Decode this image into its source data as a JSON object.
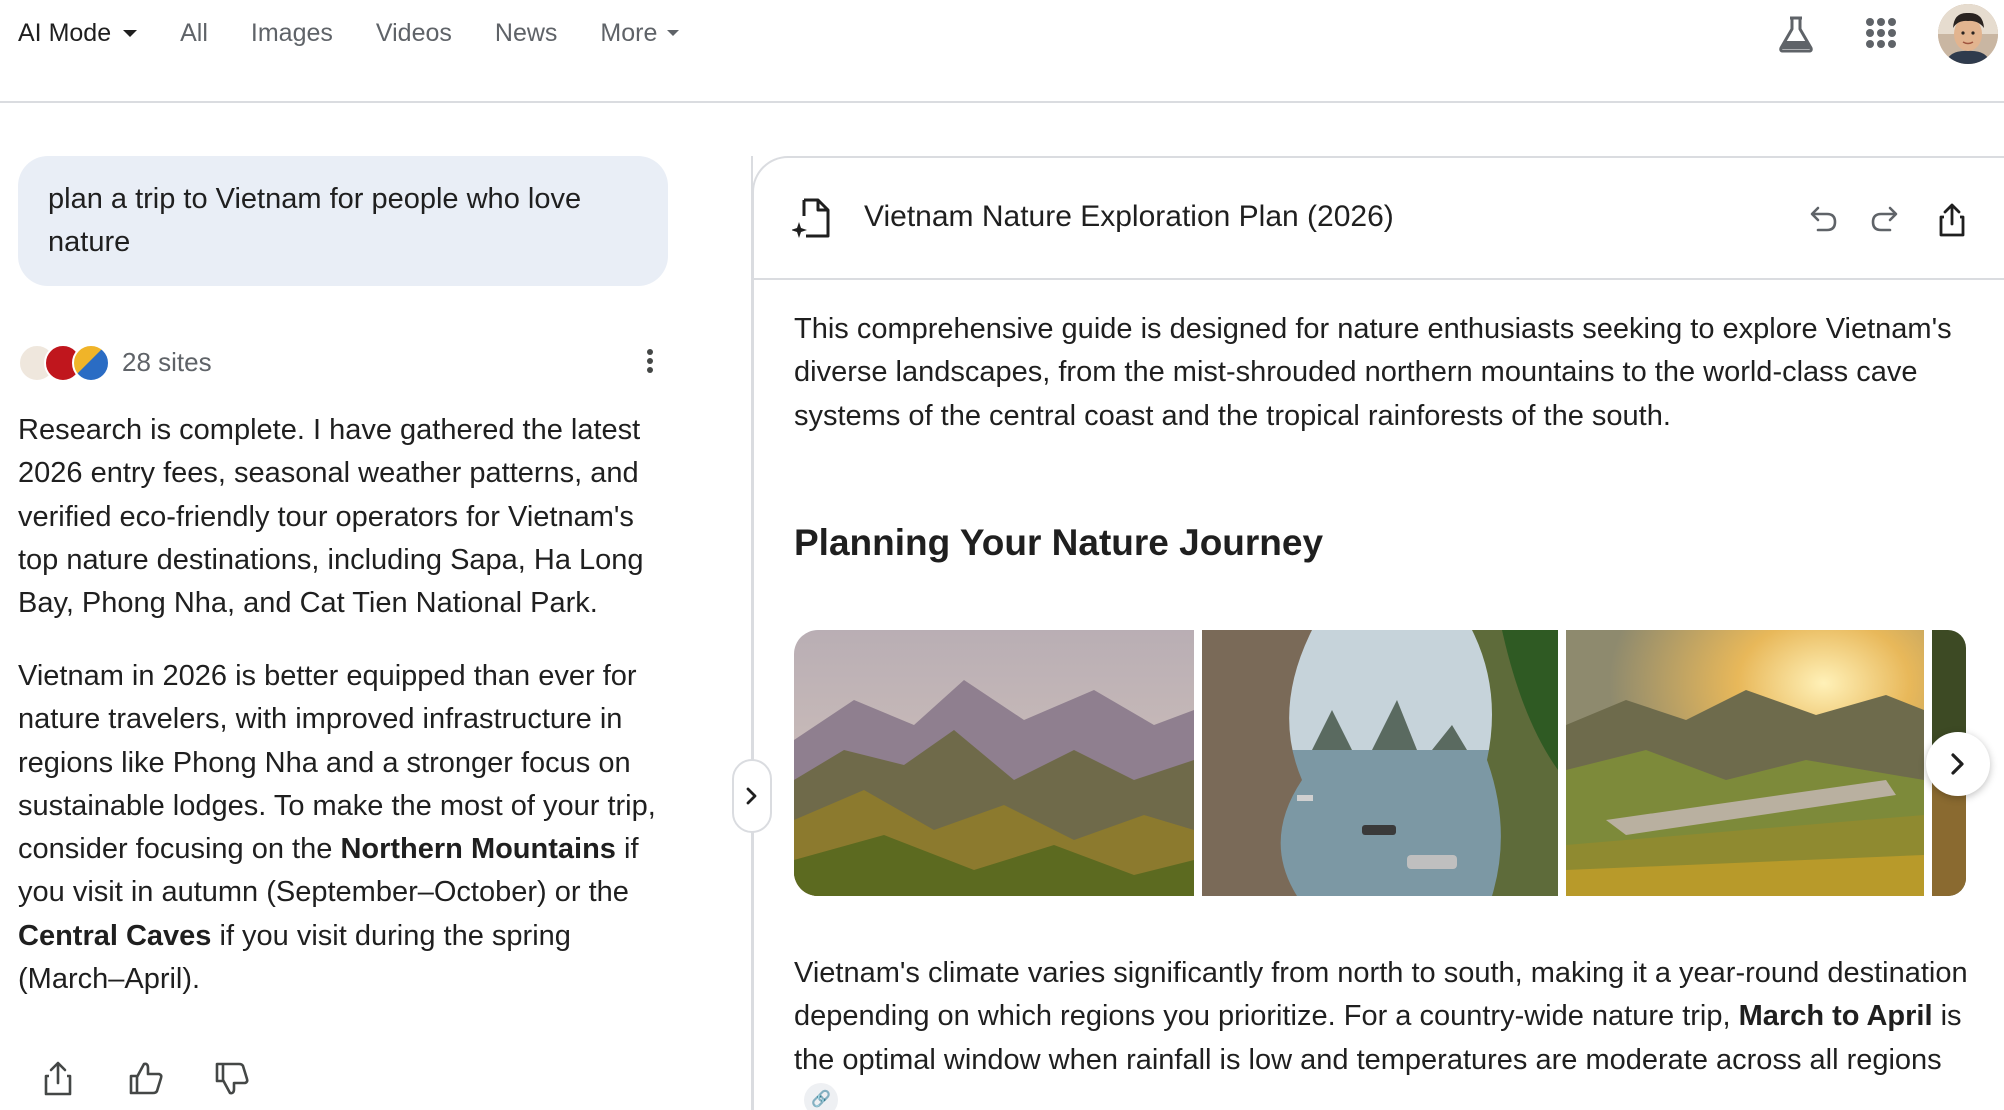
{
  "nav": {
    "items": [
      {
        "label": "AI Mode",
        "active": true
      },
      {
        "label": "All"
      },
      {
        "label": "Images"
      },
      {
        "label": "Videos"
      },
      {
        "label": "News"
      },
      {
        "label": "More"
      }
    ],
    "icons": [
      "labs-flask-icon",
      "google-apps-icon",
      "account-avatar"
    ]
  },
  "chat": {
    "query": "plan a trip to Vietnam for people who love nature",
    "sites_label": "28 sites",
    "p1": "Research is complete. I have gathered the latest 2026 entry fees, seasonal weather patterns, and verified eco-friendly tour operators for Vietnam's top nature destinations, including Sapa, Ha Long Bay, Phong Nha, and Cat Tien National Park.",
    "p2": {
      "t1": "Vietnam in 2026 is better equipped than ever for nature travelers, with improved infrastructure in regions like Phong Nha and a stronger focus on sustainable lodges. To make the most of your trip, consider focusing on the ",
      "b1": "Northern Mountains",
      "t2": " if you visit in autumn (September–October) or the ",
      "b2": "Central Caves",
      "t3": " if you visit during the spring (March–April)."
    }
  },
  "panel": {
    "title": "Vietnam Nature Exploration Plan (2026)",
    "intro": "This comprehensive guide is designed for nature enthusiasts seeking to explore Vietnam's diverse landscapes, from the mist-shrouded northern mountains to the world-class cave systems of the central coast and the tropical rainforests of the south.",
    "heading": "Planning Your Nature Journey",
    "climate": {
      "t1": "Vietnam's climate varies significantly from north to south, making it a year-round destination depending on which regions you prioritize. For a country-wide nature trip, ",
      "b1": "March to April",
      "t2": " is the optimal window when rainfall is low and temperatures are moderate across all regions"
    }
  },
  "colors": {
    "query_bg": "#e9eef6",
    "divider": "#dadce0",
    "muted_text": "#5f6368"
  }
}
